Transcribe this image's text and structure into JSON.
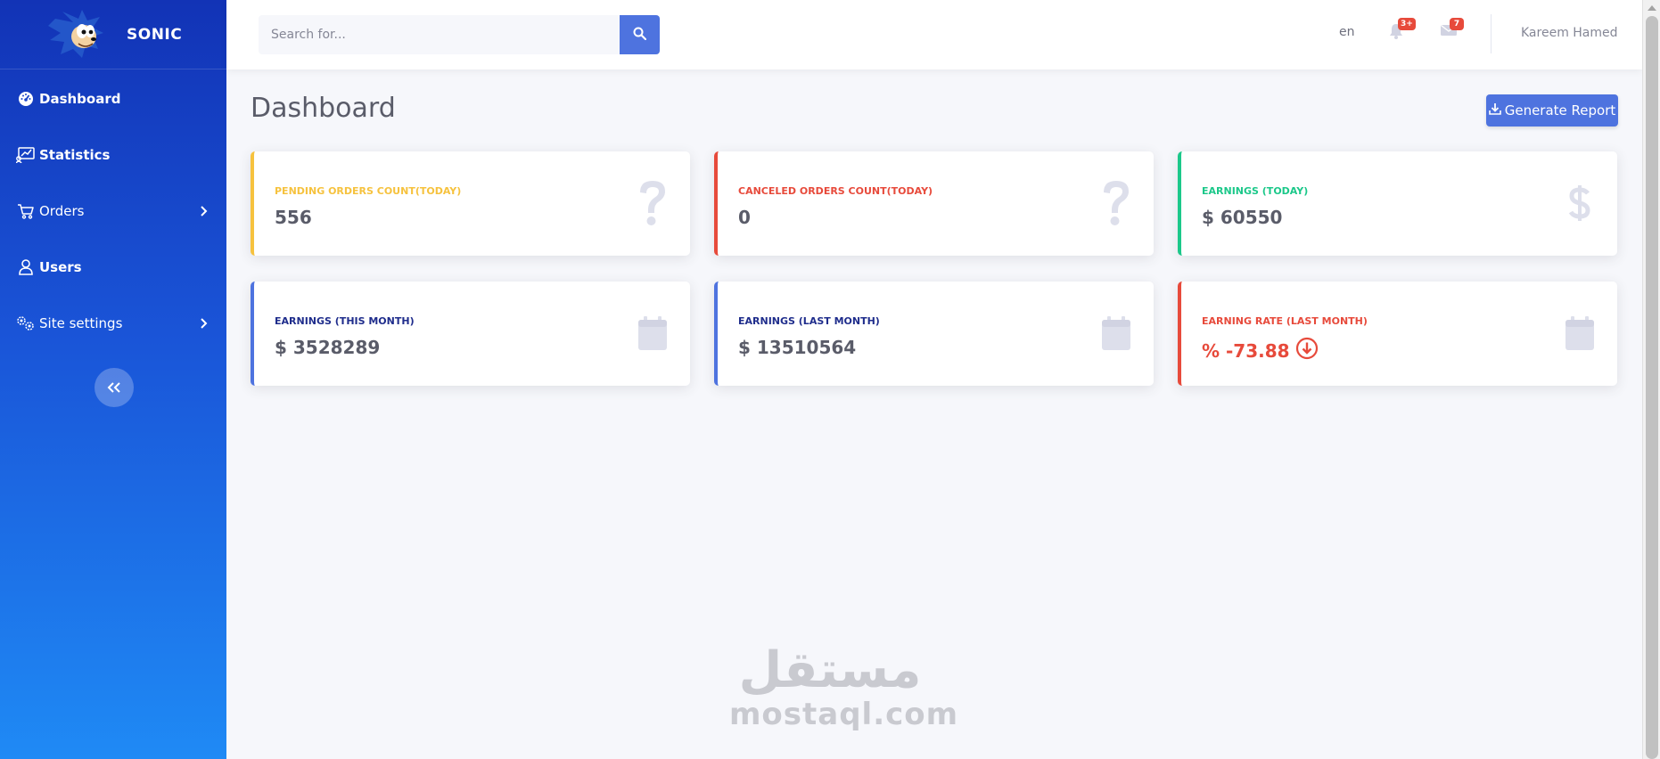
{
  "brand": {
    "name": "SONIC"
  },
  "sidebar": {
    "items": [
      {
        "label": "Dashboard",
        "icon": "gauge-icon",
        "active": true
      },
      {
        "label": "Statistics",
        "icon": "chart-icon",
        "active": true
      },
      {
        "label": "Orders",
        "icon": "cart-icon",
        "has_submenu": true
      },
      {
        "label": "Users",
        "icon": "user-icon",
        "active": true
      },
      {
        "label": "Site settings",
        "icon": "gears-icon",
        "has_submenu": true
      }
    ],
    "collapse_icon": "double-chevron-left-icon"
  },
  "topbar": {
    "search_placeholder": "Search for...",
    "language": "en",
    "notifications_badge": "3+",
    "messages_badge": "7",
    "user_name": "Kareem Hamed"
  },
  "page": {
    "title": "Dashboard",
    "report_button": "Generate Report"
  },
  "cards": [
    {
      "label": "PENDING ORDERS COUNT(TODAY)",
      "value": "556",
      "color": "#f6c23e",
      "icon": "question-icon"
    },
    {
      "label": "CANCELED ORDERS COUNT(TODAY)",
      "value": "0",
      "color": "#e74a3b",
      "icon": "question-icon"
    },
    {
      "label": "EARNINGS (TODAY)",
      "value": "$ 60550",
      "color": "#1cc88a",
      "icon": "dollar-icon"
    },
    {
      "label": "EARNINGS (THIS MONTH)",
      "value": "$ 3528289",
      "color": "#4e73df",
      "icon": "calendar-icon"
    },
    {
      "label": "EARNINGS (LAST MONTH)",
      "value": "$ 13510564",
      "color": "#4e73df",
      "icon": "calendar-icon"
    },
    {
      "label": "EARNING RATE (LAST MONTH)",
      "value": "% -73.88",
      "color": "#e74a3b",
      "icon": "calendar-icon",
      "trend": "down"
    }
  ],
  "watermark": {
    "arabic": "مستقل",
    "latin": "mostaql.com"
  },
  "colors": {
    "primary": "#4e73df",
    "warning": "#f6c23e",
    "danger": "#e74a3b",
    "success": "#1cc88a",
    "label_navy": "#1f2d8c",
    "sidebar_top": "#1233b6",
    "sidebar_bottom": "#1f8af5"
  }
}
